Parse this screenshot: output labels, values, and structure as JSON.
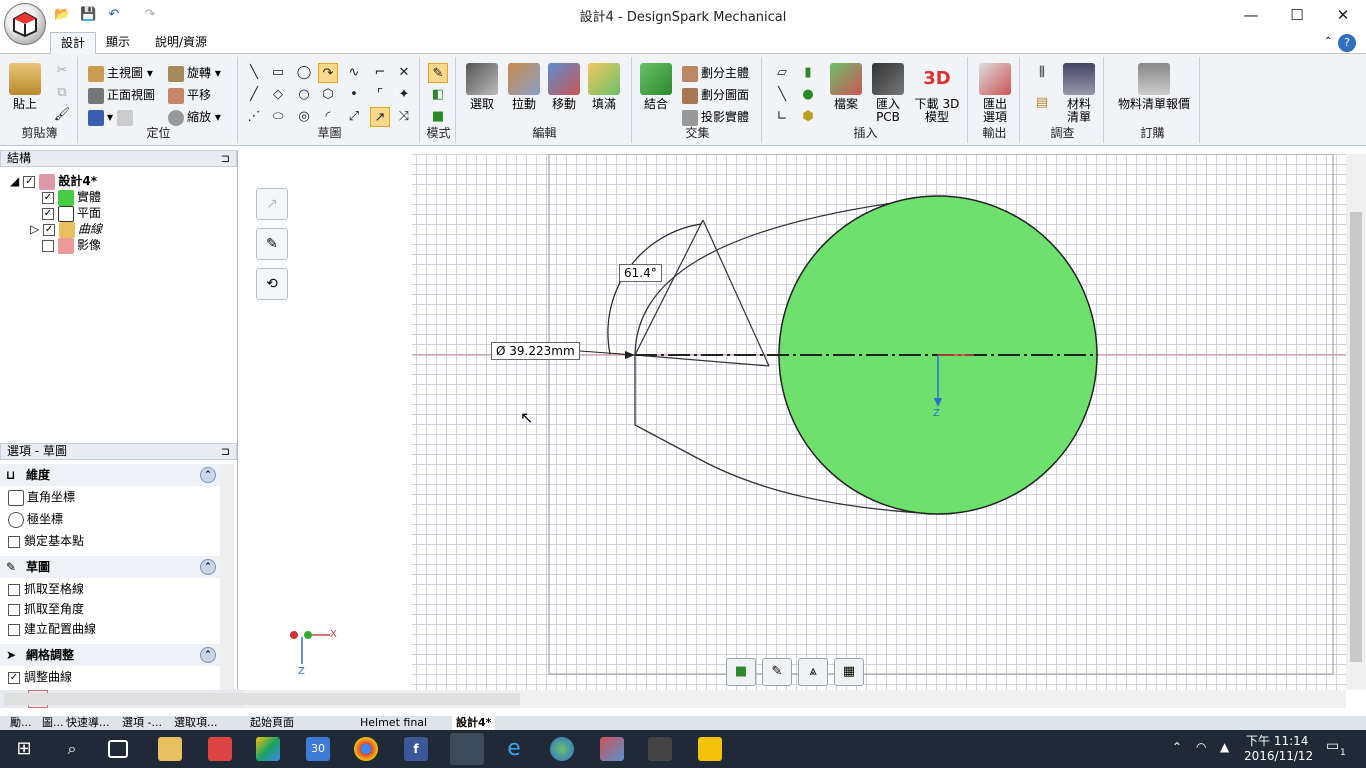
{
  "window": {
    "title": "設計4 - DesignSpark Mechanical",
    "minimize": "—",
    "maximize": "☐",
    "close": "✕"
  },
  "quick_access": [
    "📂",
    "💾",
    "↶",
    "↷"
  ],
  "tabs": [
    "設計",
    "顯示",
    "說明/資源"
  ],
  "ribbon": {
    "clipboard": {
      "paste": "貼上",
      "label": "剪貼簿"
    },
    "orient": {
      "home": "主視圖",
      "front": "正面視圖",
      "rotate": "旋轉",
      "pan": "平移",
      "zoom": "縮放",
      "label": "定位"
    },
    "sketch": {
      "label": "草圖"
    },
    "mode": {
      "label": "模式"
    },
    "edit": {
      "select": "選取",
      "pull": "拉動",
      "move": "移動",
      "fill": "填滿",
      "label": "編輯"
    },
    "intersect": {
      "combine": "結合",
      "split_body": "劃分主體",
      "split_face": "劃分圖面",
      "project": "投影實體",
      "label": "交集"
    },
    "insert": {
      "file": "檔案",
      "pcb": "匯入\nPCB",
      "download": "下載 3D\n模型",
      "label": "插入"
    },
    "output": {
      "export": "匯出\n選項",
      "label": "輸出"
    },
    "investigate": {
      "bom": "材料\n清單",
      "label": "調查"
    },
    "order": {
      "quote": "物料清單報價",
      "label": "訂購"
    }
  },
  "structure_panel": {
    "title": "結構",
    "root": "設計4*",
    "items": [
      "實體",
      "平面",
      "曲線",
      "影像"
    ]
  },
  "options_panel": {
    "title": "選項 - 草圖",
    "sections": [
      {
        "title": "維度",
        "options": [
          "直角坐標",
          "極坐標",
          "鎖定基本點"
        ]
      },
      {
        "title": "草圖",
        "options": [
          "抓取至格線",
          "抓取至角度",
          "建立配置曲線"
        ]
      },
      {
        "title": "網格調整",
        "options": [
          "調整曲線"
        ]
      }
    ]
  },
  "canvas": {
    "angle_dimension": "61.4°",
    "diameter_dimension": "Ø  39.223mm",
    "axis_z": "Z",
    "axis_x": "X"
  },
  "doc_tabs": [
    "勵...",
    "圖...",
    "快速導...",
    "選項 -...",
    "選取項...",
    "起始頁面",
    "Helmet final",
    "設計4*"
  ],
  "taskbar": {
    "time": "下午 11:14",
    "date": "2016/11/12",
    "calendar_day": "30",
    "notifications": "1"
  },
  "colors": {
    "accent": "#1d5aa8",
    "circle_fill": "#6ee06e",
    "grid": "#cfd3e0",
    "taskbar": "#1f2a36"
  }
}
